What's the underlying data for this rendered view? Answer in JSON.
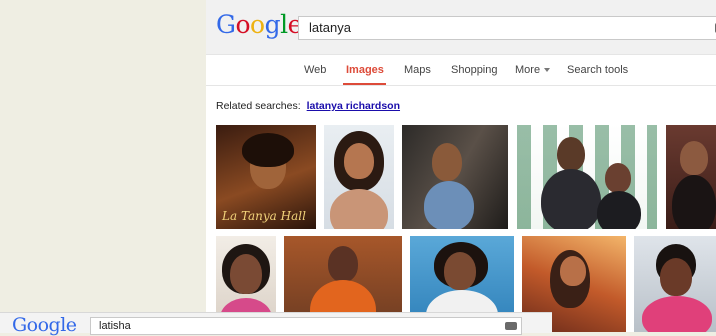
{
  "header": {
    "logo_letters": [
      "G",
      "o",
      "o",
      "g",
      "l",
      "e"
    ],
    "logo_colors": [
      "#3369e8",
      "#d50f25",
      "#eeb211",
      "#3369e8",
      "#009925",
      "#d50f25"
    ],
    "search_value": "latanya"
  },
  "tabs": [
    {
      "label": "Web"
    },
    {
      "label": "Images"
    },
    {
      "label": "Maps"
    },
    {
      "label": "Shopping"
    },
    {
      "label": "More"
    },
    {
      "label": "Search tools"
    }
  ],
  "related": {
    "label": "Related searches:",
    "link": "latanya richardson"
  },
  "image_results": [
    {
      "caption": "La Tanya Hall"
    },
    {
      "caption": ""
    },
    {
      "caption": ""
    },
    {
      "caption": ""
    },
    {
      "caption": ""
    },
    {
      "caption": ""
    },
    {
      "caption": ""
    },
    {
      "caption": ""
    },
    {
      "caption": ""
    },
    {
      "caption": ""
    }
  ],
  "bottom_search": {
    "logo": "Google",
    "search_value": "latisha"
  },
  "colors": {
    "active_tab": "#dd4b39",
    "link": "#1a0dab"
  }
}
